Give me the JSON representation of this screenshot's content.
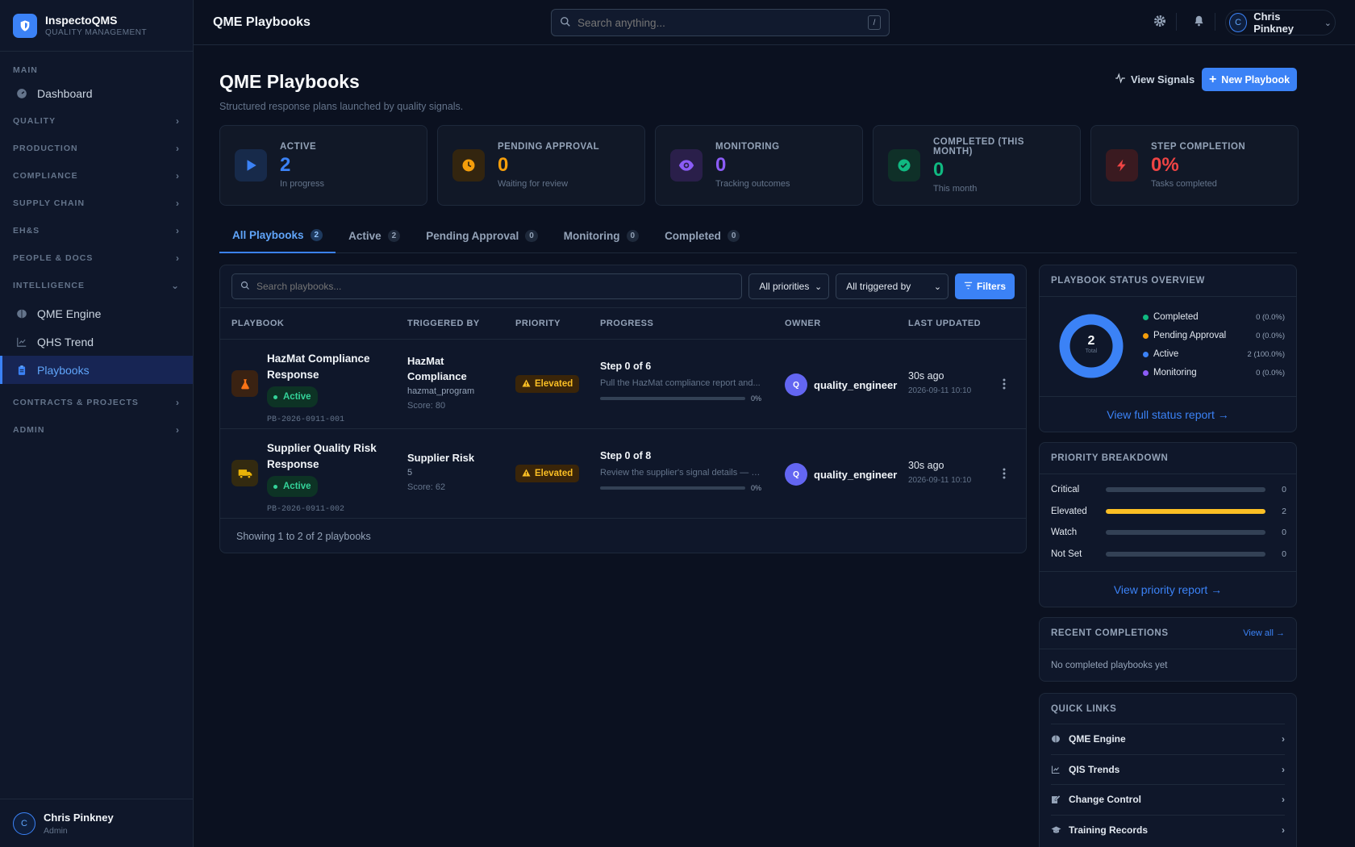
{
  "brand": {
    "name": "InspectoQMS",
    "subtitle": "QUALITY MANAGEMENT"
  },
  "sidebar": {
    "sections": [
      {
        "label": "MAIN",
        "items": [
          {
            "label": "Dashboard",
            "icon": "gauge-icon"
          }
        ]
      },
      {
        "label": "QUALITY"
      },
      {
        "label": "PRODUCTION"
      },
      {
        "label": "COMPLIANCE"
      },
      {
        "label": "SUPPLY CHAIN"
      },
      {
        "label": "EH&S"
      },
      {
        "label": "PEOPLE & DOCS"
      },
      {
        "label": "INTELLIGENCE",
        "items": [
          {
            "label": "QME Engine",
            "icon": "brain-icon"
          },
          {
            "label": "QHS Trend",
            "icon": "chart-line-icon"
          },
          {
            "label": "Playbooks",
            "icon": "clipboard-icon",
            "active": true
          }
        ]
      },
      {
        "label": "CONTRACTS & PROJECTS"
      },
      {
        "label": "ADMIN"
      }
    ],
    "user": {
      "initial": "C",
      "name": "Chris Pinkney",
      "role": "Admin"
    }
  },
  "topbar": {
    "title": "QME Playbooks",
    "search_placeholder": "Search anything...",
    "search_shortcut": "/",
    "user_initial": "C",
    "user_name": "Chris Pinkney"
  },
  "page": {
    "title": "QME Playbooks",
    "subtitle": "Structured response plans launched by quality signals.",
    "view_signals": "View Signals",
    "new_playbook": "New Playbook"
  },
  "stats": [
    {
      "label": "ACTIVE",
      "value": "2",
      "sub": "In progress",
      "color": "#3b82f6",
      "bg": "#172a4a",
      "icon": "play-icon"
    },
    {
      "label": "PENDING APPROVAL",
      "value": "0",
      "sub": "Waiting for review",
      "color": "#f59e0b",
      "bg": "#33250f",
      "icon": "clock-icon"
    },
    {
      "label": "MONITORING",
      "value": "0",
      "sub": "Tracking outcomes",
      "color": "#8b5cf6",
      "bg": "#2a1f4a",
      "icon": "eye-icon"
    },
    {
      "label": "COMPLETED (THIS MONTH)",
      "value": "0",
      "sub": "This month",
      "color": "#10b981",
      "bg": "#0f3028",
      "icon": "check-circle-icon"
    },
    {
      "label": "STEP COMPLETION",
      "value": "0%",
      "sub": "Tasks completed",
      "color": "#ef4444",
      "bg": "#3a1a20",
      "icon": "bolt-icon"
    }
  ],
  "tabs": [
    {
      "label": "All Playbooks",
      "count": "2",
      "active": true
    },
    {
      "label": "Active",
      "count": "2"
    },
    {
      "label": "Pending Approval",
      "count": "0"
    },
    {
      "label": "Monitoring",
      "count": "0"
    },
    {
      "label": "Completed",
      "count": "0"
    }
  ],
  "table": {
    "search_placeholder": "Search playbooks...",
    "priority_filter": "All priorities",
    "trigger_filter": "All triggered by",
    "filters_label": "Filters",
    "columns": [
      "PLAYBOOK",
      "TRIGGERED BY",
      "PRIORITY",
      "PROGRESS",
      "OWNER",
      "LAST UPDATED"
    ],
    "rows": [
      {
        "name": "HazMat Compliance Response",
        "status": "Active",
        "id": "PB-2026-0911-001",
        "icon": "flask-icon",
        "icon_color": "#f97316",
        "icon_bg": "#3a2212",
        "trigger": "HazMat Compliance",
        "trigger_meta": "hazmat_program",
        "score": "Score: 80",
        "priority": "Elevated",
        "step": "Step 0 of 6",
        "step_desc": "Pull the HazMat compliance report and...",
        "progress_pct": "0%",
        "owner_initial": "Q",
        "owner": "quality_engineer",
        "updated_rel": "30s ago",
        "updated_abs": "2026-09-11 10:10"
      },
      {
        "name": "Supplier Quality Risk Response",
        "status": "Active",
        "id": "PB-2026-0911-002",
        "icon": "truck-icon",
        "icon_color": "#eab308",
        "icon_bg": "#332a10",
        "trigger": "Supplier Risk",
        "trigger_meta": "5",
        "score": "Score: 62",
        "priority": "Elevated",
        "step": "Step 0 of 8",
        "step_desc": "Review the supplier's signal details — n...",
        "progress_pct": "0%",
        "owner_initial": "Q",
        "owner": "quality_engineer",
        "updated_rel": "30s ago",
        "updated_abs": "2026-09-11 10:10"
      }
    ],
    "footer": "Showing 1 to 2 of 2 playbooks"
  },
  "status_overview": {
    "title": "PLAYBOOK STATUS OVERVIEW",
    "total": "2",
    "total_label": "Total",
    "legend": [
      {
        "label": "Completed",
        "value": "0 (0.0%)",
        "color": "#10b981"
      },
      {
        "label": "Pending Approval",
        "value": "0 (0.0%)",
        "color": "#f59e0b"
      },
      {
        "label": "Active",
        "value": "2 (100.0%)",
        "color": "#3b82f6"
      },
      {
        "label": "Monitoring",
        "value": "0 (0.0%)",
        "color": "#8b5cf6"
      }
    ],
    "link": "View full status report →"
  },
  "priority_breakdown": {
    "title": "PRIORITY BREAKDOWN",
    "max": 2,
    "rows": [
      {
        "label": "Critical",
        "value": 0
      },
      {
        "label": "Elevated",
        "value": 2
      },
      {
        "label": "Watch",
        "value": 0
      },
      {
        "label": "Not Set",
        "value": 0
      }
    ],
    "link": "View priority report →"
  },
  "recent_completions": {
    "title": "RECENT COMPLETIONS",
    "view_all": "View all →",
    "empty": "No completed playbooks yet"
  },
  "quick_links": {
    "title": "QUICK LINKS",
    "items": [
      {
        "label": "QME Engine",
        "icon": "brain-icon"
      },
      {
        "label": "QIS Trends",
        "icon": "chart-line-icon"
      },
      {
        "label": "Change Control",
        "icon": "edit-icon"
      },
      {
        "label": "Training Records",
        "icon": "graduation-cap-icon"
      }
    ]
  }
}
